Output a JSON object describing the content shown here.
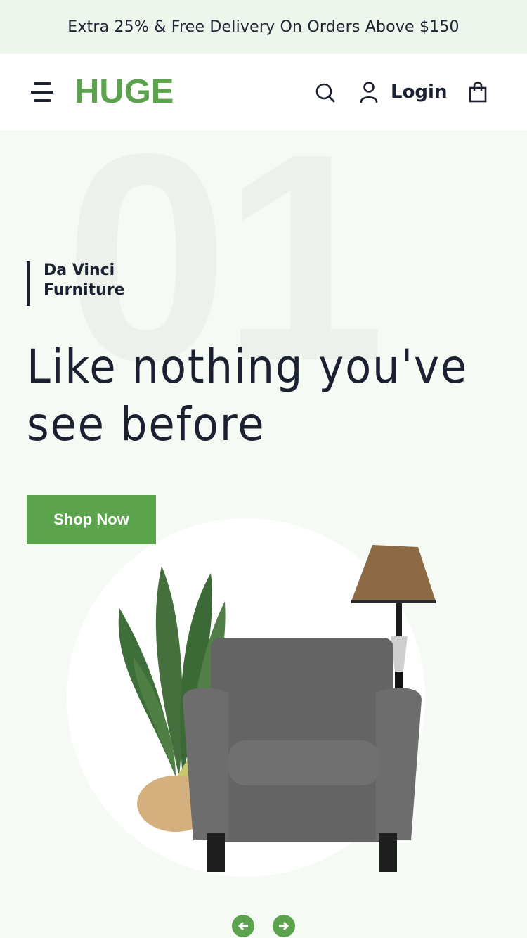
{
  "promo_bar": {
    "text": "Extra 25% & Free Delivery On Orders Above $150"
  },
  "header": {
    "logo": "HUGE",
    "login_label": "Login",
    "icons": [
      "menu-icon",
      "search-icon",
      "user-icon",
      "shopping-bag-icon"
    ]
  },
  "hero": {
    "slide_number": "01",
    "subtitle_line1": "Da Vinci",
    "subtitle_line2": "Furniture",
    "title_line1": "Like nothing you've",
    "title_line2": "see before",
    "cta_label": "Shop Now",
    "image_alt": "Gray armchair with potted plant and floor lamp"
  },
  "carousel": {
    "prev_icon": "arrow-left-icon",
    "next_icon": "arrow-right-icon"
  },
  "colors": {
    "brand_green": "#5ca34e",
    "promo_bg": "#eef5ec",
    "hero_bg": "#f5faf4",
    "text_dark": "#1b2130"
  }
}
